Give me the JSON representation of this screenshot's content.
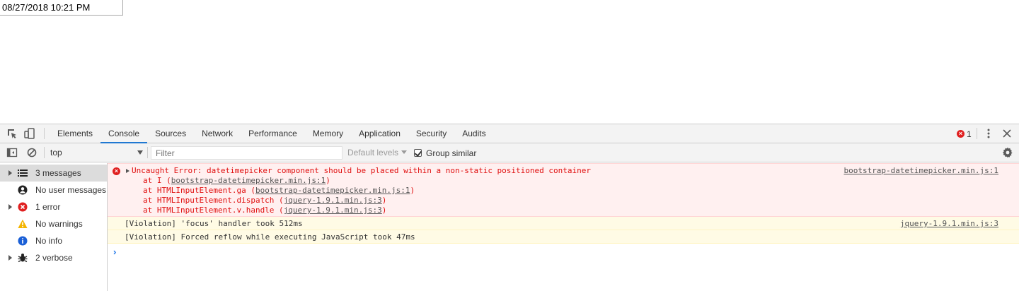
{
  "page": {
    "datetime_value": "08/27/2018 10:21 PM"
  },
  "devtools": {
    "tabs": [
      {
        "label": "Elements"
      },
      {
        "label": "Console",
        "active": true
      },
      {
        "label": "Sources"
      },
      {
        "label": "Network"
      },
      {
        "label": "Performance"
      },
      {
        "label": "Memory"
      },
      {
        "label": "Application"
      },
      {
        "label": "Security"
      },
      {
        "label": "Audits"
      }
    ],
    "error_count": "1",
    "toolbar": {
      "context": "top",
      "filter_placeholder": "Filter",
      "levels_label": "Default levels",
      "group_similar_label": "Group similar"
    },
    "sidebar": {
      "items": [
        {
          "label": "3 messages",
          "icon": "list-icon"
        },
        {
          "label": "No user messages",
          "icon": "user-icon"
        },
        {
          "label": "1 error",
          "icon": "error-icon"
        },
        {
          "label": "No warnings",
          "icon": "warning-icon"
        },
        {
          "label": "No info",
          "icon": "info-icon"
        },
        {
          "label": "2 verbose",
          "icon": "bug-icon"
        }
      ]
    },
    "console": {
      "error": {
        "message": "Uncaught Error: datetimepicker component should be placed within a non-static positioned container",
        "source": "bootstrap-datetimepicker.min.js:1",
        "stack": [
          {
            "prefix": "at I (",
            "link": "bootstrap-datetimepicker.min.js:1",
            "suffix": ")"
          },
          {
            "prefix": "at HTMLInputElement.ga (",
            "link": "bootstrap-datetimepicker.min.js:1",
            "suffix": ")"
          },
          {
            "prefix": "at HTMLInputElement.dispatch (",
            "link": "jquery-1.9.1.min.js:3",
            "suffix": ")"
          },
          {
            "prefix": "at HTMLInputElement.v.handle (",
            "link": "jquery-1.9.1.min.js:3",
            "suffix": ")"
          }
        ]
      },
      "violations": [
        {
          "text": "[Violation] 'focus' handler took 512ms",
          "source": "jquery-1.9.1.min.js:3"
        },
        {
          "text": "[Violation] Forced reflow while executing JavaScript took 47ms",
          "source": ""
        }
      ],
      "prompt": "›"
    }
  },
  "colors": {
    "error": "#e01010",
    "error_bg": "#fff0f0",
    "warning_bg": "#fffbe5",
    "accent": "#1a73e8"
  }
}
